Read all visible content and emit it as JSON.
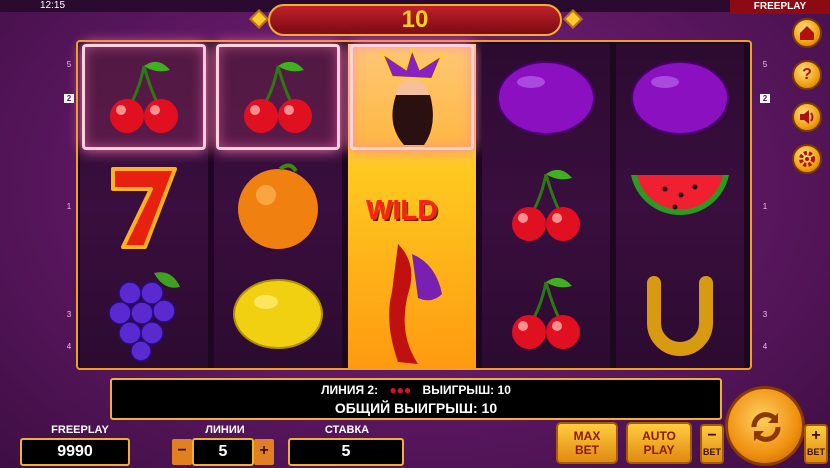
{
  "status": {
    "time": "12:15",
    "mode": "FREEPLAY"
  },
  "win_banner": {
    "value": "10"
  },
  "reels": {
    "reel1": [
      "cherry",
      "seven",
      "grapes"
    ],
    "reel2": [
      "cherry",
      "orange",
      "lemon"
    ],
    "reel3": [
      "joker-wild"
    ],
    "reel4": [
      "plum",
      "cherry",
      "cherry"
    ],
    "reel5": [
      "plum",
      "watermelon",
      "horseshoe"
    ],
    "wild_label": "WILD",
    "highlighted": [
      "reel1-row1",
      "reel2-row1",
      "reel3-row1"
    ]
  },
  "line_markers": {
    "left": [
      "5",
      "2",
      "1",
      "3",
      "4"
    ],
    "right": [
      "5",
      "2",
      "1",
      "3",
      "4"
    ],
    "active": "2"
  },
  "side_buttons": [
    {
      "name": "home",
      "icon": "home-icon"
    },
    {
      "name": "help",
      "icon": "question-icon",
      "label": "?"
    },
    {
      "name": "sound",
      "icon": "speaker-icon"
    },
    {
      "name": "settings",
      "icon": "gear-icon"
    }
  ],
  "info": {
    "line_label": "ЛИНИЯ 2:",
    "line_symbols": "cherry-icons",
    "win_label": "ВЫИГРЫШ: 10",
    "total_win": "ОБЩИЙ ВЫИГРЫШ: 10"
  },
  "controls": {
    "balance_label": "FREEPLAY",
    "balance_value": "9990",
    "lines_label": "ЛИНИИ",
    "lines_value": "5",
    "bet_label": "СТАВКА",
    "bet_value": "5",
    "minus": "−",
    "plus": "+",
    "max_bet_line1": "MAX",
    "max_bet_line2": "BET",
    "auto_play_line1": "AUTO",
    "auto_play_line2": "PLAY",
    "bet_minus_sign": "−",
    "bet_minus_label": "BET",
    "bet_plus_sign": "+",
    "bet_plus_label": "BET"
  },
  "colors": {
    "background": "#5c1760",
    "gold": "#f0b030",
    "highlight": "#ff7ab0",
    "banner_red": "#c0202a"
  }
}
